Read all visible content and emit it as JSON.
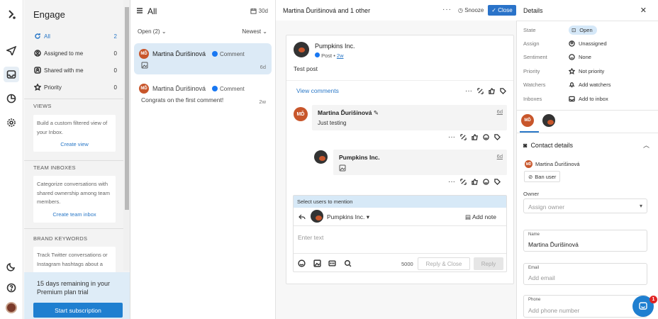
{
  "nav": {
    "title": "Engage",
    "items": [
      {
        "label": "All",
        "count": "2",
        "icon": "refresh-icon"
      },
      {
        "label": "Assigned to me",
        "count": "0",
        "icon": "user-circle-icon"
      },
      {
        "label": "Shared with me",
        "count": "0",
        "icon": "share-icon"
      },
      {
        "label": "Priority",
        "count": "0",
        "icon": "star-icon"
      }
    ],
    "views": {
      "heading": "VIEWS",
      "desc": "Build a custom filtered view of your Inbox.",
      "link": "Create view"
    },
    "team": {
      "heading": "TEAM INBOXES",
      "desc": "Categorize conversations with shared ownership among team members.",
      "link": "Create team inbox"
    },
    "brand": {
      "heading": "BRAND KEYWORDS",
      "desc": "Track Twitter conversations or Instagram hashtags about a"
    },
    "trial": {
      "text": "15 days remaining in your Premium plan trial",
      "button": "Start subscription"
    }
  },
  "list": {
    "title": "All",
    "days": "30d",
    "filter": "Open (2)",
    "sort": "Newest",
    "conversations": [
      {
        "initials": "MĎ",
        "name": "Martina Ďurišinová",
        "channel": "Comment",
        "preview": "",
        "age": "6d"
      },
      {
        "initials": "MĎ",
        "name": "Martina Ďurišinová",
        "channel": "Comment",
        "preview": "Congrats on the first comment!",
        "age": "2w"
      }
    ]
  },
  "main": {
    "title": "Martina Ďurišinová and 1 other",
    "snooze": "Snooze",
    "close": "Close",
    "post": {
      "author": "Pumpkins Inc.",
      "type": "Post",
      "age": "2w",
      "text": "Test post",
      "view_comments": "View comments"
    },
    "comment1": {
      "initials": "MĎ",
      "author": "Martina Ďurišinová",
      "age": "6d",
      "text": "Just testing"
    },
    "comment2": {
      "author": "Pumpkins Inc.",
      "age": "6d"
    },
    "reply": {
      "mention": "Select users to mention",
      "from": "Pumpkins Inc.",
      "add_note": "Add note",
      "placeholder": "Enter text",
      "count": "5000",
      "reply_close": "Reply & Close",
      "reply": "Reply"
    }
  },
  "details": {
    "title": "Details",
    "rows": [
      {
        "label": "State",
        "value": "Open"
      },
      {
        "label": "Assign",
        "value": "Unassigned"
      },
      {
        "label": "Sentiment",
        "value": "None"
      },
      {
        "label": "Priority",
        "value": "Not priority"
      },
      {
        "label": "Watchers",
        "value": "Add watchers"
      },
      {
        "label": "Inboxes",
        "value": "Add to inbox"
      }
    ],
    "tab_initials": "MĎ",
    "contact_title": "Contact details",
    "contact_initials": "MĎ",
    "contact_name": "Martina Ďurišinová",
    "ban": "Ban user",
    "owner_label": "Owner",
    "owner_placeholder": "Assign owner",
    "name_label": "Name",
    "name_value": "Martina Ďurišinová",
    "email_label": "Email",
    "email_placeholder": "Add email",
    "phone_label": "Phone",
    "phone_placeholder": "Add phone number",
    "chat_badge": "1"
  }
}
